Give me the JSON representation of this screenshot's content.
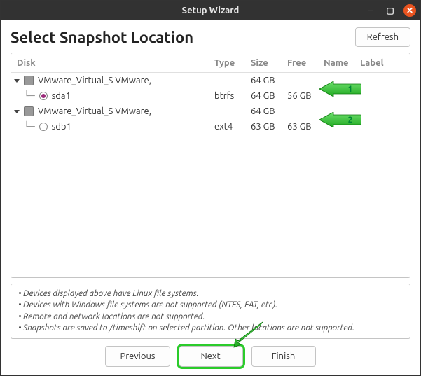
{
  "window": {
    "title": "Setup Wizard"
  },
  "page": {
    "title": "Select Snapshot Location"
  },
  "buttons": {
    "refresh": "Refresh",
    "previous": "Previous",
    "next": "Next",
    "finish": "Finish"
  },
  "columns": {
    "disk": "Disk",
    "type": "Type",
    "size": "Size",
    "free": "Free",
    "name": "Name",
    "label": "Label"
  },
  "rows": {
    "d0": {
      "label": "VMware_Virtual_S VMware,",
      "size": "64 GB"
    },
    "p0": {
      "label": "sda1",
      "type": "btrfs",
      "size": "64 GB",
      "free": "56 GB"
    },
    "d1": {
      "label": "VMware_Virtual_S VMware,",
      "size": "64 GB"
    },
    "p1": {
      "label": "sdb1",
      "type": "ext4",
      "size": "63 GB",
      "free": "63 GB"
    }
  },
  "callouts": {
    "one": "1",
    "two": "2"
  },
  "notes": {
    "l1": "• Devices displayed above have Linux file systems.",
    "l2": "• Devices with Windows file systems are not supported (NTFS, FAT, etc).",
    "l3": "• Remote and network locations are not supported.",
    "l4": "• Snapshots are saved to /timeshift on selected partition. Other locations are not supported."
  }
}
